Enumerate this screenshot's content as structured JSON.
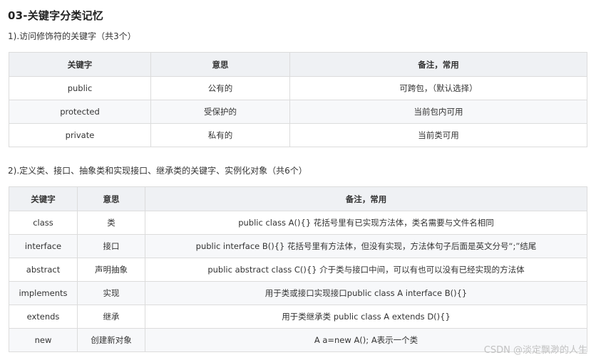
{
  "title": "03-关键字分类记忆",
  "section1": {
    "heading": "1).访问修饰符的关键字（共3个）",
    "headers": [
      "关键字",
      "意思",
      "备注，常用"
    ],
    "rows": [
      [
        "public",
        "公有的",
        "可跨包，（默认选择）"
      ],
      [
        "protected",
        "受保护的",
        "当前包内可用"
      ],
      [
        "private",
        "私有的",
        "当前类可用"
      ]
    ]
  },
  "section2": {
    "heading": "2).定义类、接口、抽象类和实现接口、继承类的关键字、实例化对象（共6个）",
    "headers": [
      "关键字",
      "意思",
      "备注，常用"
    ],
    "rows": [
      [
        "class",
        "类",
        "public class A(){} 花括号里有已实现方法体，类名需要与文件名相同"
      ],
      [
        "interface",
        "接口",
        "public interface B(){} 花括号里有方法体，但没有实现，方法体句子后面是英文分号“;”结尾"
      ],
      [
        "abstract",
        "声明抽象",
        "public abstract class C(){} 介于类与接口中间，可以有也可以没有已经实现的方法体"
      ],
      [
        "implements",
        "实现",
        "用于类或接口实现接口public class A interface B(){}"
      ],
      [
        "extends",
        "继承",
        "用于类继承类 public class A extends D(){}"
      ],
      [
        "new",
        "创建新对象",
        "A a=new A(); A表示一个类"
      ]
    ]
  },
  "watermark": "CSDN @淡定飘渺的人生"
}
